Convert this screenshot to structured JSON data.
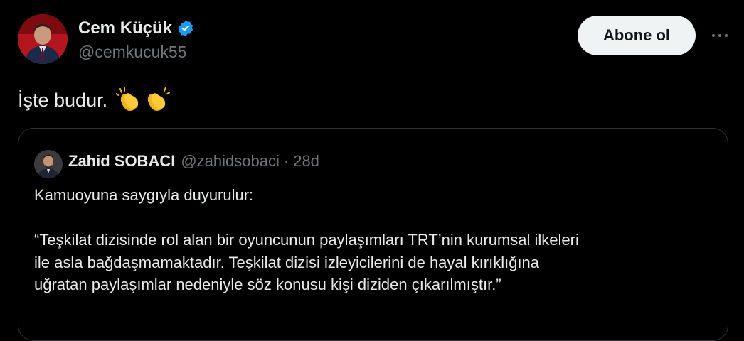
{
  "author": {
    "name": "Cem Küçük",
    "handle": "@cemkucuk55",
    "verified": true
  },
  "follow_button": {
    "label": "Abone ol"
  },
  "more_button": {
    "icon": "more-horizontal-icon"
  },
  "tweet": {
    "text": "İşte budur.",
    "emojis": [
      "clapping-hands-emoji",
      "clapping-hands-emoji"
    ]
  },
  "quote": {
    "author_name": "Zahid SOBACI",
    "author_handle": "@zahidsobaci",
    "separator": "·",
    "time": "28d",
    "line1": "Kamuoyuna saygıyla duyurulur:",
    "line2": "“Teşkilat dizisinde rol alan bir oyuncunun paylaşımları TRT’nin kurumsal ilkeleri",
    "line3": "ile asla bağdaşmamaktadır. Teşkilat dizisi izleyicilerini de hayal kırıklığına",
    "line4": "uğratan paylaşımlar nedeniyle söz konusu kişi diziden çıkarılmıştır.”"
  },
  "colors": {
    "background": "#000000",
    "text": "#e7e9ea",
    "secondary_text": "#71767b",
    "verified_badge": "#1d9bf0",
    "follow_button_bg": "#eff3f4",
    "border": "#2f3336"
  }
}
